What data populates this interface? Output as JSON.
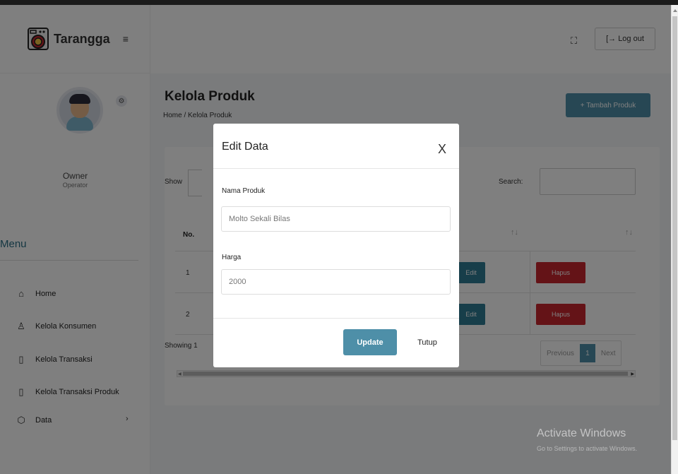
{
  "brand": {
    "name": "Tarangga",
    "toggle_icon": "≡"
  },
  "profile": {
    "name": "Owner",
    "role": "Operator"
  },
  "menu": {
    "heading": "Menu",
    "items": [
      {
        "label": "Home",
        "icon": "home-icon",
        "glyph": "⌂"
      },
      {
        "label": "Kelola Konsumen",
        "icon": "user-icon",
        "glyph": "♙"
      },
      {
        "label": "Kelola Transaksi",
        "icon": "file-icon",
        "glyph": "▯"
      },
      {
        "label": "Kelola Transaksi Produk",
        "icon": "file-icon",
        "glyph": "▯"
      },
      {
        "label": "Data",
        "icon": "box-icon",
        "glyph": "⬡"
      }
    ],
    "data_caret": "›"
  },
  "topbar": {
    "expand_glyph": "⛶",
    "logout_label": "[→ Log out"
  },
  "page": {
    "title": "Kelola Produk",
    "breadcrumb": "Home / Kelola Produk",
    "add_button": "+ Tambah Produk"
  },
  "table": {
    "show_label": "Show",
    "search_label": "Search:",
    "header_no": "No.",
    "sort_glyph": "↑↓",
    "rows": [
      {
        "no": "1",
        "edit": "Edit",
        "hapus": "Hapus"
      },
      {
        "no": "2",
        "edit": "Edit",
        "hapus": "Hapus"
      }
    ],
    "showing": "Showing 1",
    "pager": {
      "previous": "Previous",
      "current": "1",
      "next": "Next"
    }
  },
  "modal": {
    "title": "Edit Data",
    "close": "X",
    "fields": [
      {
        "label": "Nama Produk",
        "value": "Molto Sekali Bilas"
      },
      {
        "label": "Harga",
        "value": "2000"
      }
    ],
    "update_label": "Update",
    "close_label": "Tutup"
  },
  "watermark": {
    "title": "Activate Windows",
    "subtitle": "Go to Settings to activate Windows."
  },
  "colors": {
    "accent": "#4e8fa8",
    "danger": "#c9262f",
    "edit": "#2f7c94"
  }
}
